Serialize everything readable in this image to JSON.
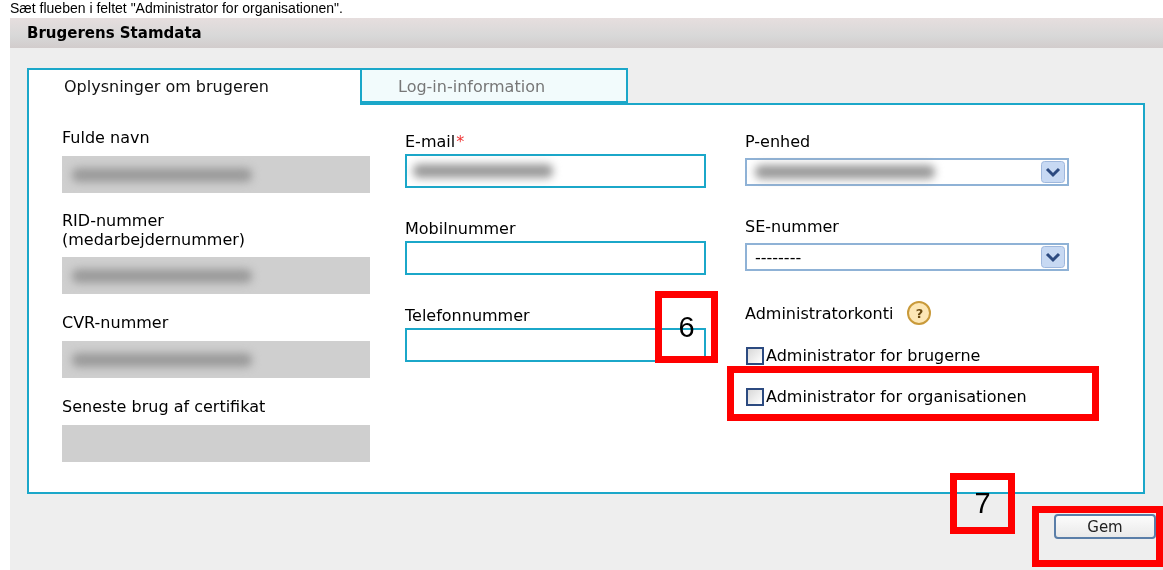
{
  "caption": "Sæt flueben i feltet \"Administrator for organisationen\".",
  "section": {
    "title": "Brugerens Stamdata"
  },
  "tabs": [
    {
      "label": "Oplysninger om brugeren",
      "selected": true
    },
    {
      "label": "Log-in-information",
      "selected": false
    }
  ],
  "columns": [
    {
      "fields": [
        {
          "kind": "readonly",
          "label": "Fulde navn",
          "redacted": true
        },
        {
          "kind": "readonly",
          "label": "RID-nummer (medarbejdernummer)",
          "redacted": true
        },
        {
          "kind": "readonly",
          "label": "CVR-nummer",
          "redacted": true
        },
        {
          "kind": "readonly",
          "label": "Seneste brug af certifikat",
          "redacted": false
        }
      ]
    },
    {
      "fields": [
        {
          "kind": "text",
          "label": "E-mail",
          "required_mark": "*",
          "redacted": true
        },
        {
          "kind": "text",
          "label": "Mobilnummer",
          "redacted": false
        },
        {
          "kind": "text",
          "label": "Telefonnummer",
          "redacted": false
        }
      ]
    },
    {
      "fields": [
        {
          "kind": "select",
          "label": "P-enhed",
          "redacted": true
        },
        {
          "kind": "select",
          "label": "SE-nummer",
          "value": "--------",
          "redacted": false
        },
        {
          "kind": "group",
          "label": "Administratorkonti",
          "help": "?",
          "checkboxes": [
            {
              "label": "Administrator for brugerne",
              "checked": false
            },
            {
              "label": "Administrator for organisationen",
              "checked": false
            }
          ]
        }
      ]
    }
  ],
  "button": "Gem",
  "annotations": [
    {
      "kind": "number",
      "text": "6"
    },
    {
      "kind": "highlight"
    },
    {
      "kind": "number",
      "text": "7"
    },
    {
      "kind": "highlight"
    }
  ]
}
